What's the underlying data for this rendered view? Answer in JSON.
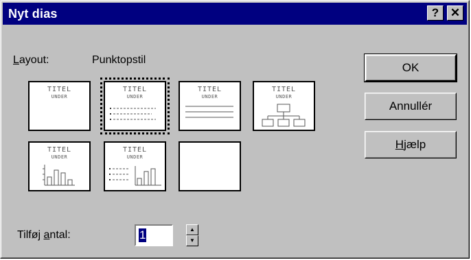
{
  "window": {
    "title": "Nyt dias",
    "help_label": "?",
    "close_label": "✕"
  },
  "layout": {
    "label_prefix": "",
    "label_access": "L",
    "label_rest": "ayout:",
    "current": "Punktopstil",
    "thumb_title": "TITEL",
    "thumb_sub": "UNDER",
    "thumbnails": [
      {
        "name": "title-only"
      },
      {
        "name": "bullets",
        "selected": true
      },
      {
        "name": "text"
      },
      {
        "name": "org-chart"
      },
      {
        "name": "chart"
      },
      {
        "name": "bullets-chart"
      },
      {
        "name": "blank"
      }
    ]
  },
  "buttons": {
    "ok": "OK",
    "cancel": "Annullér",
    "help_access": "H",
    "help_rest": "jælp"
  },
  "count": {
    "label_pre": "Tilføj ",
    "label_access": "a",
    "label_post": "ntal:",
    "value": "1"
  }
}
